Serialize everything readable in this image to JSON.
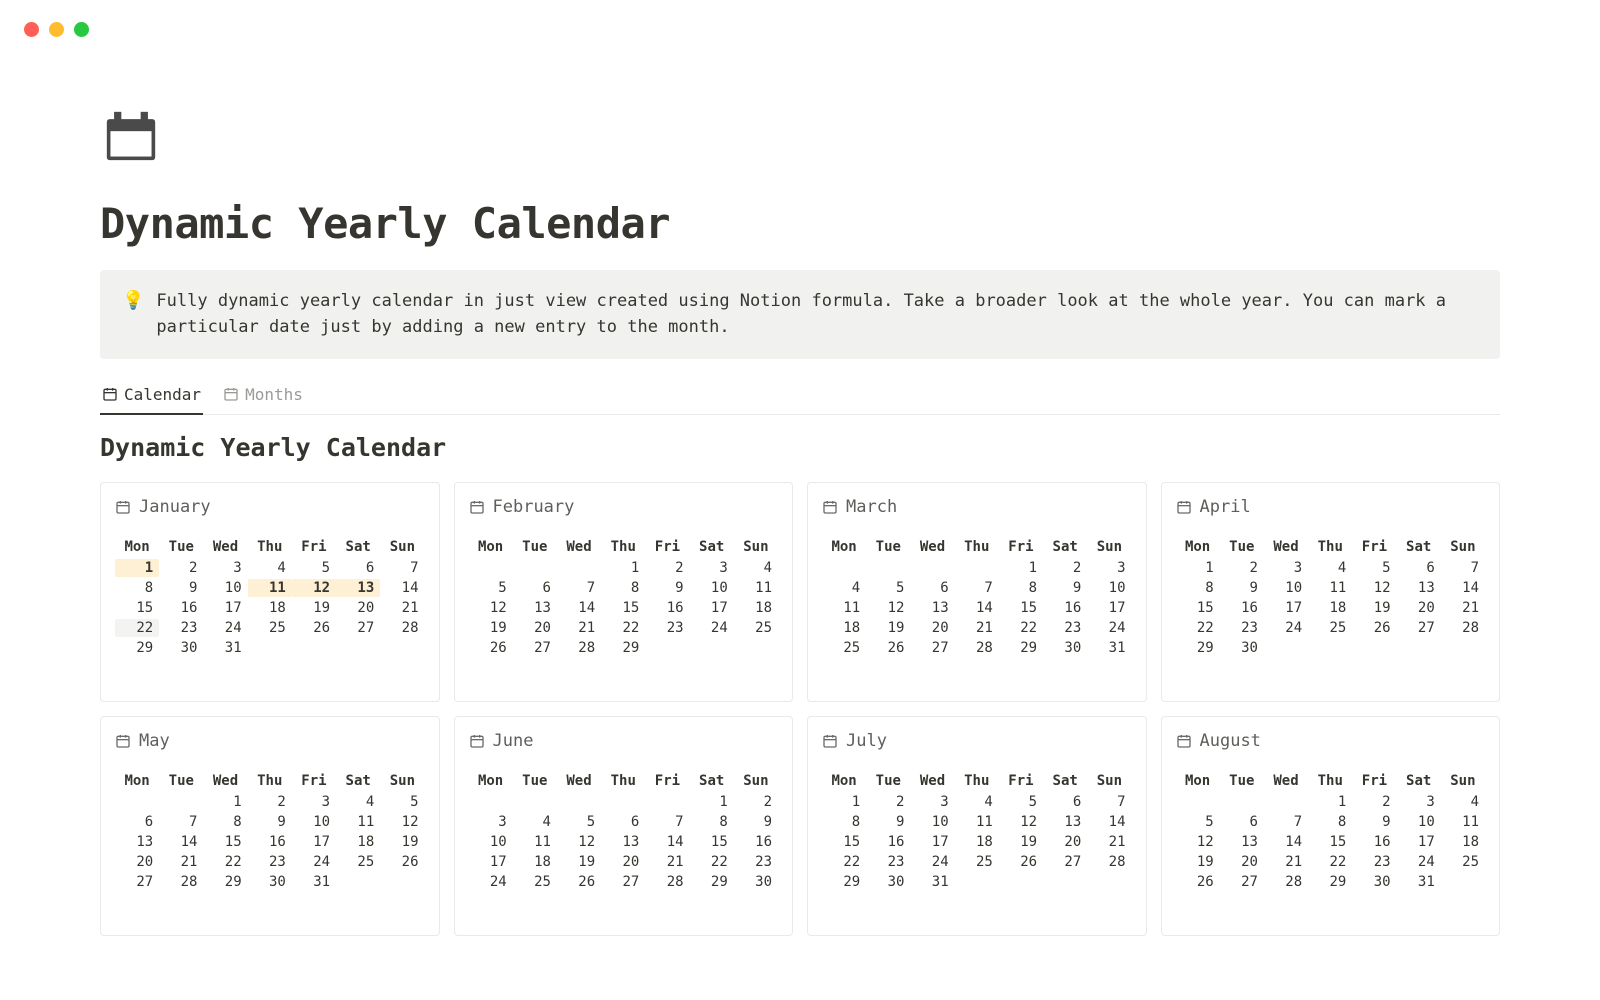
{
  "title": "Dynamic Yearly Calendar",
  "callout": {
    "emoji": "💡",
    "text": "Fully dynamic yearly calendar in just view created using Notion formula. Take a broader look at the whole year. You can mark a particular date just by adding a new entry to the month."
  },
  "tabs": {
    "calendar": "Calendar",
    "months": "Months"
  },
  "subheading": "Dynamic Yearly Calendar",
  "daysOfWeek": [
    "Mon",
    "Tue",
    "Wed",
    "Thu",
    "Fri",
    "Sat",
    "Sun"
  ],
  "months": [
    {
      "name": "January",
      "startDow": 0,
      "numDays": 31,
      "highlights": [
        1,
        11,
        12,
        13
      ],
      "weakHighlights": [
        22
      ]
    },
    {
      "name": "February",
      "startDow": 3,
      "numDays": 29,
      "highlights": [],
      "weakHighlights": []
    },
    {
      "name": "March",
      "startDow": 4,
      "numDays": 31,
      "highlights": [],
      "weakHighlights": []
    },
    {
      "name": "April",
      "startDow": 0,
      "numDays": 30,
      "highlights": [],
      "weakHighlights": []
    },
    {
      "name": "May",
      "startDow": 2,
      "numDays": 31,
      "highlights": [],
      "weakHighlights": []
    },
    {
      "name": "June",
      "startDow": 5,
      "numDays": 30,
      "highlights": [],
      "weakHighlights": []
    },
    {
      "name": "July",
      "startDow": 0,
      "numDays": 31,
      "highlights": [],
      "weakHighlights": []
    },
    {
      "name": "August",
      "startDow": 3,
      "numDays": 31,
      "highlights": [],
      "weakHighlights": []
    }
  ]
}
